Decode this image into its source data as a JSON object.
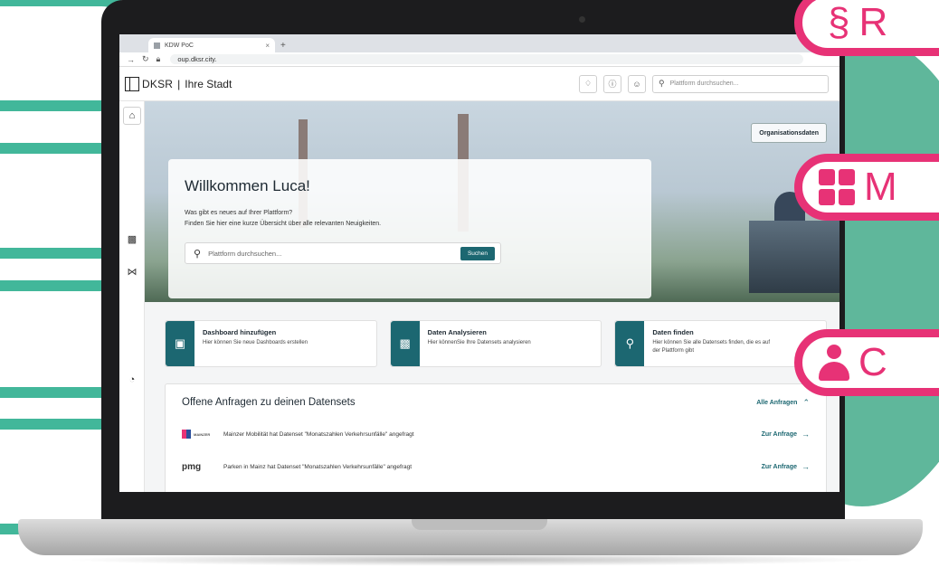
{
  "browser": {
    "tab_title": "KDW PoC",
    "tab_close": "×",
    "new_tab": "+",
    "url": "oup.dksr.city."
  },
  "header": {
    "brand": "DKSR",
    "separator": "|",
    "city": "Ihre Stadt",
    "search_placeholder": "Plattform durchsuchen..."
  },
  "hero": {
    "title": "Willkommen Luca!",
    "line1": "Was gibt es neues auf Ihrer Plattform?",
    "line2": "Finden Sie hier eine kurze Übersicht über alle relevanten Neuigkeiten.",
    "search_placeholder": "Plattform durchsuchen...",
    "search_button": "Suchen",
    "org_button": "Organisationsdaten"
  },
  "actions": [
    {
      "title": "Dashboard hinzufügen",
      "desc": "Hier können Sie neue Dashboards erstellen"
    },
    {
      "title": "Daten Analysieren",
      "desc": "Hier könnenSie Ihre Datensets analysieren"
    },
    {
      "title": "Daten finden",
      "desc": "Hier können Sie alle Datensets finden, die es auf der Plattform gibt"
    }
  ],
  "requests": {
    "title": "Offene Anfragen zu deinen Datensets",
    "all_label": "Alle Anfragen",
    "rows": [
      {
        "logo": "MAINZER",
        "text": "Mainzer Mobilität hat Datenset \"Monatszahlen Verkehrsunfälle\" angefragt",
        "link": "Zur Anfrage"
      },
      {
        "logo": "pmg",
        "text": "Parken in Mainz hat Datenset \"Monatszahlen Verkehrsunfälle\" angefragt",
        "link": "Zur Anfrage"
      }
    ]
  },
  "pills": [
    {
      "text": "R"
    },
    {
      "text": "M"
    },
    {
      "text": "C"
    }
  ],
  "colors": {
    "teal": "#1c6771",
    "green_outline": "#42b79a",
    "pink": "#e73276"
  }
}
